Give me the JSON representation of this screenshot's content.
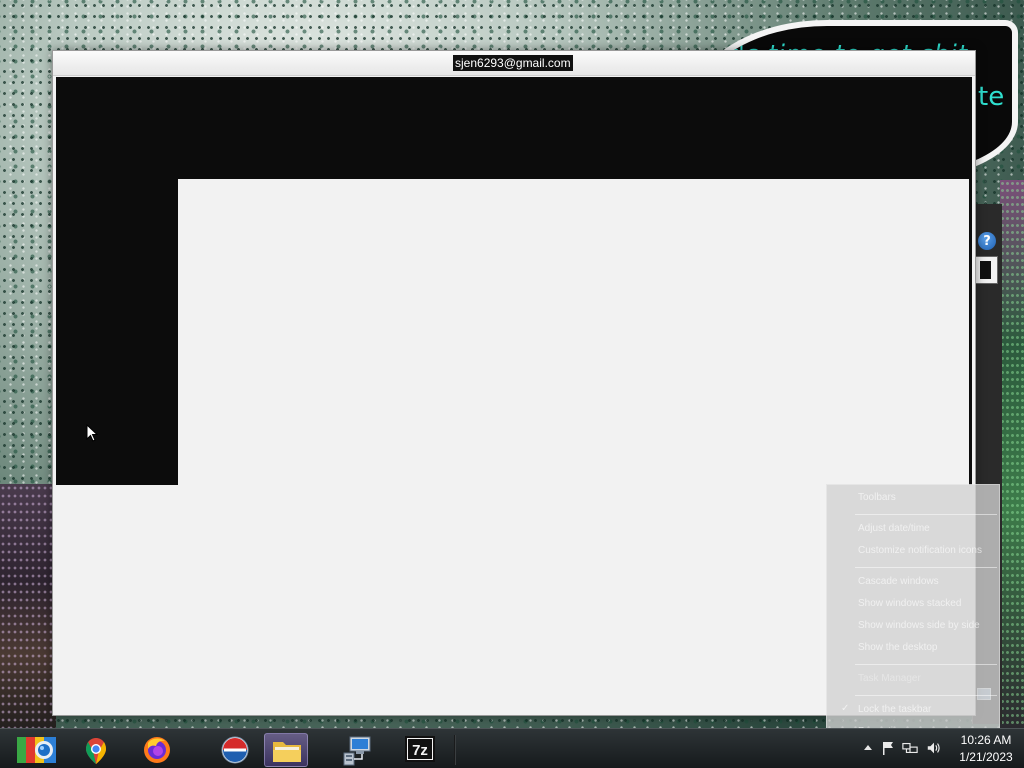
{
  "wallpaper": {
    "quote_line_1": "it's time to get shit",
    "quote_line_2": "te",
    "accent_color": "#2fe0d0"
  },
  "window": {
    "title": "sjen6293@gmail.com",
    "content_black": "#0c0c0c",
    "content_light": "#f2f2f2"
  },
  "background_window": {
    "help_icon_label": "?"
  },
  "context_menu": {
    "items": [
      "Toolbars",
      "Adjust date/time",
      "Customize notification icons",
      "Cascade windows",
      "Show windows stacked",
      "Show windows side by side",
      "Show the desktop",
      "Task Manager",
      "Lock the taskbar",
      "Properties"
    ],
    "lock_taskbar_checked": true,
    "check_glyph": "✓"
  },
  "taskbar": {
    "pinned": [
      {
        "name": "start-button"
      },
      {
        "name": "chrome-icon"
      },
      {
        "name": "firefox-icon"
      },
      {
        "name": "opera-icon"
      },
      {
        "name": "file-explorer-icon"
      },
      {
        "name": "network-setup-icon"
      },
      {
        "name": "7zip-icon",
        "label": "7z"
      }
    ],
    "tray_icons": [
      "show-hidden-icons-arrow",
      "flag-icon",
      "network-icon",
      "volume-icon"
    ],
    "clock": {
      "time": "10:26 AM",
      "date": "1/21/2023"
    }
  }
}
